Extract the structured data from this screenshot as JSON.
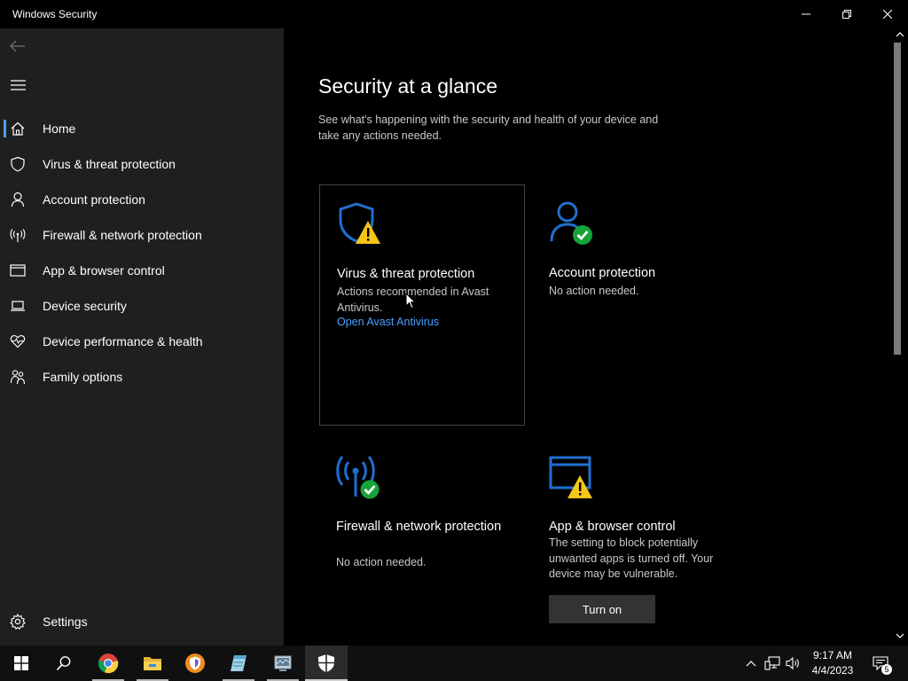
{
  "window": {
    "title": "Windows Security"
  },
  "sidebar": {
    "items": [
      {
        "label": "Home",
        "icon": "home-icon",
        "selected": true
      },
      {
        "label": "Virus & threat protection",
        "icon": "shield-icon"
      },
      {
        "label": "Account protection",
        "icon": "person-icon"
      },
      {
        "label": "Firewall & network protection",
        "icon": "antenna-icon"
      },
      {
        "label": "App & browser control",
        "icon": "browser-window-icon"
      },
      {
        "label": "Device security",
        "icon": "laptop-icon"
      },
      {
        "label": "Device performance & health",
        "icon": "heart-icon"
      },
      {
        "label": "Family options",
        "icon": "family-icon"
      }
    ],
    "settings_label": "Settings"
  },
  "main": {
    "title": "Security at a glance",
    "subtitle": "See what's happening with the security and health of your device and take any actions needed.",
    "cards": [
      {
        "title": "Virus & threat protection",
        "description": "Actions recommended in Avast Antivirus.",
        "link": "Open Avast Antivirus",
        "status": "warning"
      },
      {
        "title": "Account protection",
        "description": "No action needed.",
        "status": "ok"
      },
      {
        "title": "Firewall & network protection",
        "description": "No action needed.",
        "status": "ok"
      },
      {
        "title": "App & browser control",
        "description": "The setting to block potentially unwanted apps is turned off. Your device may be vulnerable.",
        "button": "Turn on",
        "status": "warning"
      }
    ]
  },
  "taskbar": {
    "time": "9:17 AM",
    "date": "4/4/2023",
    "notification_count": "5"
  },
  "colors": {
    "accent": "#4aa0ff",
    "icon_blue": "#1f6fcf",
    "warning": "#f5c518",
    "ok": "#16a33a",
    "sidebar_bg": "#1f1f1f"
  }
}
